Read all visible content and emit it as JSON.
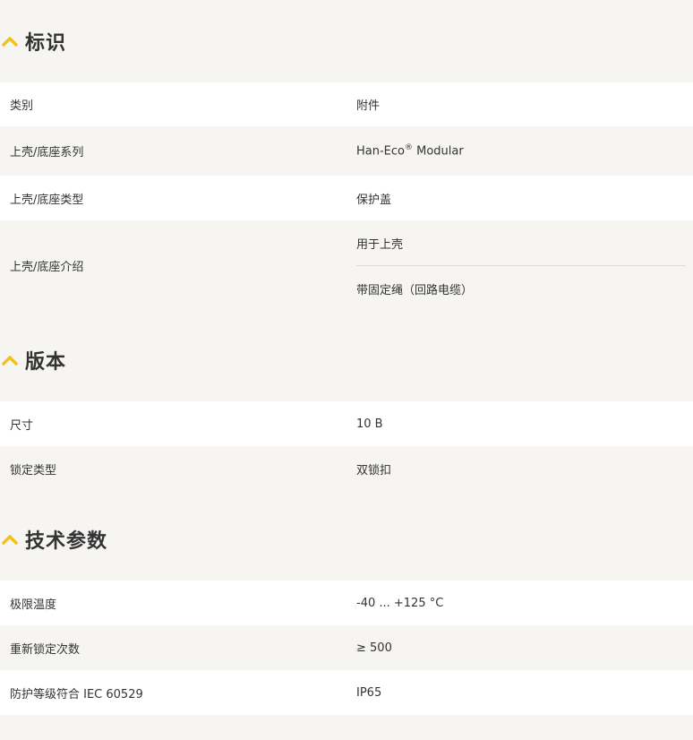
{
  "sections": [
    {
      "title": "标识",
      "rows": [
        {
          "label": "类别",
          "value": "附件"
        },
        {
          "label": "上壳/底座系列",
          "value": "Han-Eco",
          "value_sup": "®",
          "value_suffix": " Modular"
        },
        {
          "label": "上壳/底座类型",
          "value": "保护盖"
        },
        {
          "label": "上壳/底座介绍",
          "values": [
            "用于上壳",
            "带固定绳（回路电缆）"
          ]
        }
      ]
    },
    {
      "title": "版本",
      "rows": [
        {
          "label": "尺寸",
          "value": "10 B"
        },
        {
          "label": "锁定类型",
          "value": "双锁扣"
        }
      ]
    },
    {
      "title": "技术参数",
      "rows": [
        {
          "label": "极限温度",
          "value": "-40 ... +125 °C"
        },
        {
          "label": "重新锁定次数",
          "value": "≥ 500"
        },
        {
          "label": "防护等级符合 IEC 60529",
          "value": "IP65"
        }
      ]
    }
  ],
  "colors": {
    "accent": "#f2c21b",
    "row_white": "#ffffff",
    "row_grey": "#f6f5f2"
  },
  "icons": {
    "section_toggle": "chevron-up-icon"
  }
}
